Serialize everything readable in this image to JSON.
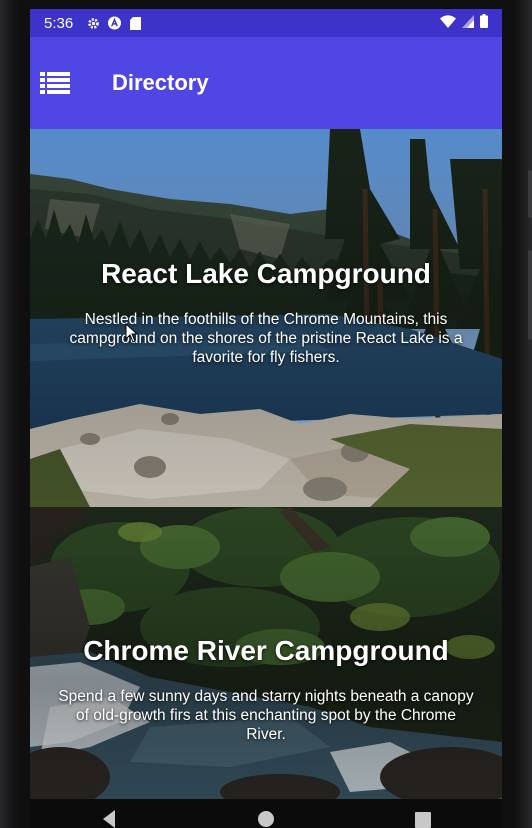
{
  "status_bar": {
    "time": "5:36",
    "left_icons": [
      "gear-icon",
      "a-icon",
      "sd-card-icon"
    ],
    "right_icons": [
      "wifi-icon",
      "signal-icon",
      "battery-icon"
    ]
  },
  "app_bar": {
    "title": "Directory",
    "menu_icon": "list-icon"
  },
  "campsites": [
    {
      "name": "React Lake Campground",
      "description": "Nestled in the foothills of the Chrome Mountains, this campground on the shores of the pristine React Lake is a favorite for fly fishers."
    },
    {
      "name": "Chrome River Campground",
      "description": "Spend a few sunny days and starry nights beneath a canopy of old-growth firs at this enchanting spot by the Chrome River."
    }
  ],
  "nav_bar": [
    "back-icon",
    "home-icon",
    "recents-icon"
  ],
  "colors": {
    "status_bar": "#3e33c8",
    "app_bar": "#5046e4"
  }
}
